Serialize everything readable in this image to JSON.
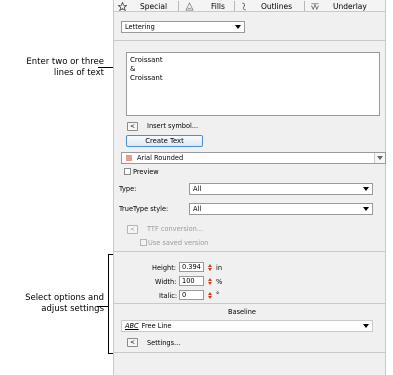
{
  "annotations": {
    "top": [
      "Enter two or three",
      "lines of text"
    ],
    "bottom": [
      "Select options and",
      "adjust settings"
    ]
  },
  "tabs": [
    {
      "label": "Special",
      "icon": "star-icon"
    },
    {
      "label": "Fills",
      "icon": "fill-icon"
    },
    {
      "label": "Outlines",
      "icon": "outline-icon"
    },
    {
      "label": "Underlay",
      "icon": "underlay-icon"
    }
  ],
  "object_type": {
    "value": "Lettering"
  },
  "text_input": {
    "value": "Croissant\n&\nCroissant"
  },
  "insert_symbol": {
    "button": "<",
    "label": "Insert symbol..."
  },
  "create_text": {
    "label": "Create Text"
  },
  "font": {
    "value": "Arial Rounded",
    "icon": "font-icon"
  },
  "preview": {
    "label": "Preview",
    "checked": false
  },
  "type": {
    "label": "Type:",
    "value": "All"
  },
  "truetype_style": {
    "label": "TrueType style:",
    "value": "All"
  },
  "ttf_conversion": {
    "button": "<",
    "label": "TTF conversion..."
  },
  "use_saved_version": {
    "label": "Use saved version",
    "checked": false
  },
  "height": {
    "label": "Height:",
    "value": "0.394",
    "unit": "in"
  },
  "width": {
    "label": "Width:",
    "value": "100",
    "unit": "%"
  },
  "italic": {
    "label": "Italic:",
    "value": "0",
    "unit": "°"
  },
  "baseline": {
    "title": "Baseline",
    "value": "Free Line",
    "icon_text": "ABC"
  },
  "settings": {
    "button": "<",
    "label": "Settings..."
  },
  "colors": {
    "accent": "#d13a1a",
    "button_border": "#4b8fd0",
    "panel_bg": "#f0f0f0"
  }
}
